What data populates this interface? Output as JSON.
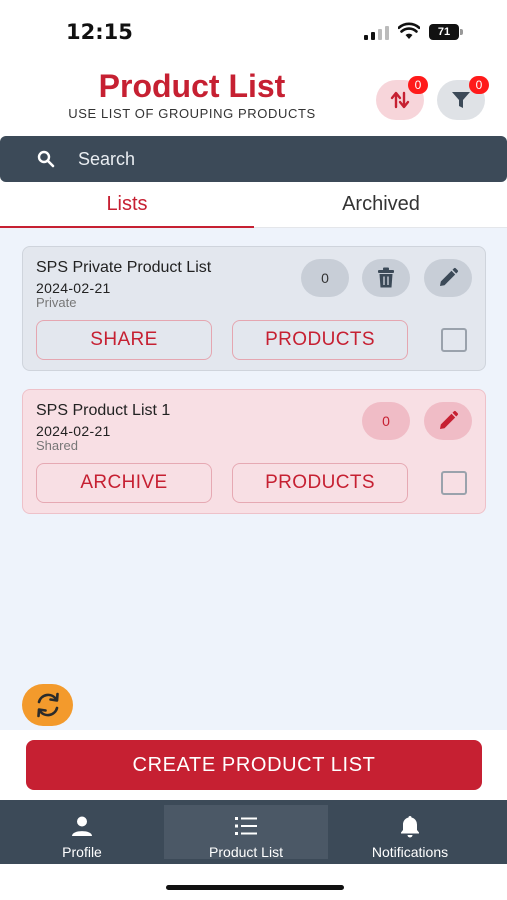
{
  "status_bar": {
    "time": "12:15",
    "battery": "71"
  },
  "header": {
    "title": "Product List",
    "subtitle": "USE LIST OF GROUPING PRODUCTS",
    "sort_badge": "0",
    "filter_badge": "0"
  },
  "search": {
    "placeholder": "Search"
  },
  "tabs": [
    {
      "label": "Lists",
      "active": true
    },
    {
      "label": "Archived",
      "active": false
    }
  ],
  "lists": [
    {
      "name": "SPS Private Product List",
      "date": "2024-02-21",
      "type": "Private",
      "count": "0",
      "left_button": "SHARE",
      "right_button": "PRODUCTS"
    },
    {
      "name": "SPS Product List 1",
      "date": "2024-02-21",
      "type": "Shared",
      "count": "0",
      "left_button": "ARCHIVE",
      "right_button": "PRODUCTS"
    }
  ],
  "create_button": "CREATE PRODUCT LIST",
  "nav": [
    {
      "label": "Profile",
      "icon": "person-icon"
    },
    {
      "label": "Product List",
      "icon": "list-icon",
      "active": true
    },
    {
      "label": "Notifications",
      "icon": "bell-icon"
    }
  ],
  "colors": {
    "accent": "#c62032",
    "dark": "#3c4a58",
    "refresh": "#f39a2c",
    "background": "#eef3fb"
  }
}
